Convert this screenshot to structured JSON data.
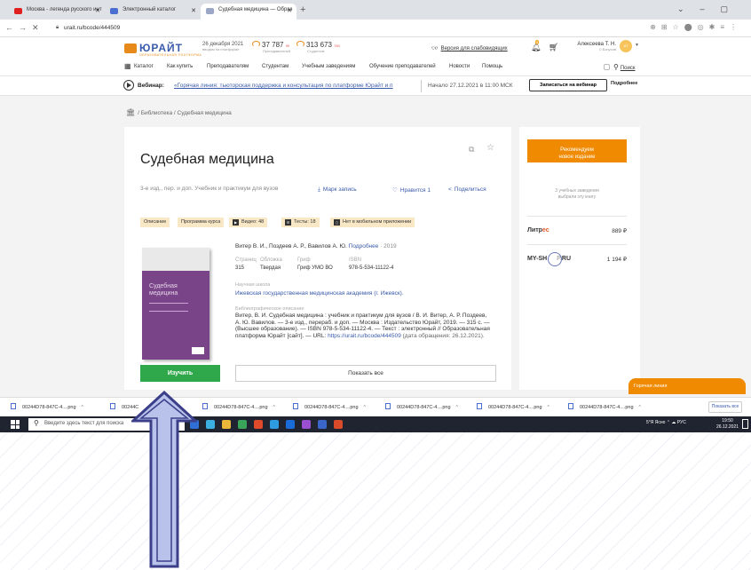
{
  "browser": {
    "tabs": [
      {
        "title": "Москва - легенда русского инт"
      },
      {
        "title": "Электронный каталог"
      },
      {
        "title": "Судебная медицина — Образ"
      }
    ],
    "url": "urait.ru/bcode/444509"
  },
  "header": {
    "logo": "ЮРАЙТ",
    "logo_sub": "ОБРАЗОВАТЕЛЬНАЯ ПЛАТФОРМА",
    "date": "26 декабря 2021",
    "date_sub": "вводим на платформе",
    "stat1": {
      "value": "37 787",
      "mark": "99",
      "label": "Преподавателей"
    },
    "stat2": {
      "value": "313 673",
      "mark": "780",
      "label": "Студентов"
    },
    "visually_impaired": "Версия для слабовидящих",
    "bell_badge": "5",
    "user_name": "Алексеева Т. Н.",
    "user_sub": "0 Бонусов",
    "avatar": "АТ",
    "menu": [
      "Каталог",
      "Как купить",
      "Преподавателям",
      "Студентам",
      "Учебным заведениям",
      "Обучение преподавателей",
      "Новости",
      "Помощь"
    ],
    "search": "Поиск"
  },
  "webinar": {
    "label": "Вебинар:",
    "link": "«Горячая линия: тьюторская поддержка и консультация по платформе Юрайт и п",
    "date": "Начало 27.12.2021 в 11:00 МСК",
    "button": "Записаться на вебинар",
    "more": "Подробнее"
  },
  "breadcrumb": "/ Библиотека / Судебная медицина",
  "book": {
    "title": "Судебная медицина",
    "subtitle": "3-е изд., пер. и доп. Учебник и практикум для вузов",
    "bookmark": "Марк запись",
    "like": "Нравится 1",
    "share": "Поделиться",
    "tags": [
      "Описание",
      "Программа курса",
      "Видео: 48",
      "Тесты: 18",
      "Нет в мобильном приложении"
    ],
    "cover_title": "Судебная медицина",
    "authors": "Витер В. И., Поздеев А. Р., Вавилов А. Ю.",
    "authors_more": "Подробнее",
    "year": "· 2019",
    "meta": [
      {
        "key": "Страниц",
        "value": "315"
      },
      {
        "key": "Обложка",
        "value": "Твердая"
      },
      {
        "key": "Гриф",
        "value": "Гриф УМО ВО"
      },
      {
        "key": "ISBN",
        "value": "978-5-534-11122-4"
      }
    ],
    "school_label": "Научная школа",
    "school": "Ижевская государственная медицинская академия (г. Ижевск).",
    "biblio_label": "Библиографическое описание",
    "biblio_text": "Витер, В. И.  Судебная медицина : учебник и практикум для вузов / В. И. Витер, А. Р. Поздеев, А. Ю. Вавилов. — 3-е изд., перераб. и доп. — Москва : Издательство Юрайт, 2019. — 315 с. — (Высшее образование). — ISBN 978-5-534-11122-4. — Текст : электронный // Образовательная платформа Юрайт [сайт]. — URL: ",
    "biblio_link": "https://urait.ru/bcode/444509",
    "biblio_date": " (дата обращения: 26.12.2021).",
    "learn_button": "Изучить",
    "show_all_button": "Показать все"
  },
  "sidebar": {
    "recommend_line1": "Рекомендуем",
    "recommend_line2": "новое издание",
    "note_line1": "3 учебных заведения",
    "note_line2": "выбрали эту книгу",
    "shops": [
      {
        "name_a": "Литр",
        "name_b": "ес",
        "price": "889 ₽"
      },
      {
        "name_a": "MY-SH",
        "name_b": "P.RU",
        "price": "1 194 ₽"
      }
    ],
    "hotline": "Горячая линия"
  },
  "downloads": {
    "item": "00244D78-847C-4....png",
    "item_short": "00244C",
    "show_all": "Показать все"
  },
  "taskbar": {
    "search": "Введите здесь текст для поиска",
    "tray": "5°Я  Ясно  ⌃  ☁  РУС",
    "time": "19:50",
    "date": "26.12.2021"
  },
  "colors": {
    "accent_orange": "#f08a00",
    "brand_blue": "#3a5bab",
    "learn_green": "#2ea84a",
    "arrow_fill": "#b8c2ea",
    "arrow_stroke": "#3b3f8a"
  }
}
